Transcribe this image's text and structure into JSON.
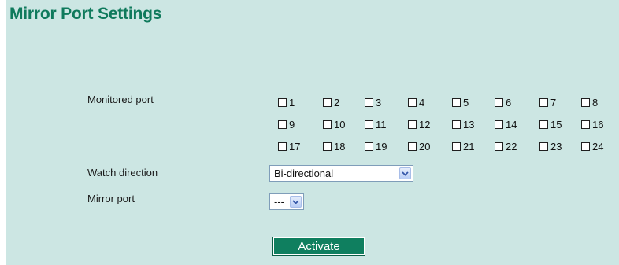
{
  "page": {
    "title": "Mirror Port Settings"
  },
  "monitored_port": {
    "label": "Monitored port",
    "ports": [
      "1",
      "2",
      "3",
      "4",
      "5",
      "6",
      "7",
      "8",
      "9",
      "10",
      "11",
      "12",
      "13",
      "14",
      "15",
      "16",
      "17",
      "18",
      "19",
      "20",
      "21",
      "22",
      "23",
      "24"
    ]
  },
  "watch_direction": {
    "label": "Watch direction",
    "value": "Bi-directional"
  },
  "mirror_port": {
    "label": "Mirror port",
    "value": "---"
  },
  "activate": {
    "label": "Activate"
  },
  "colors": {
    "background": "#cce6e3",
    "title": "#0f7a5c",
    "button": "#0f7f5f"
  },
  "icons": {
    "dropdown": "chevron-down-icon",
    "checkbox": "checkbox-icon"
  }
}
